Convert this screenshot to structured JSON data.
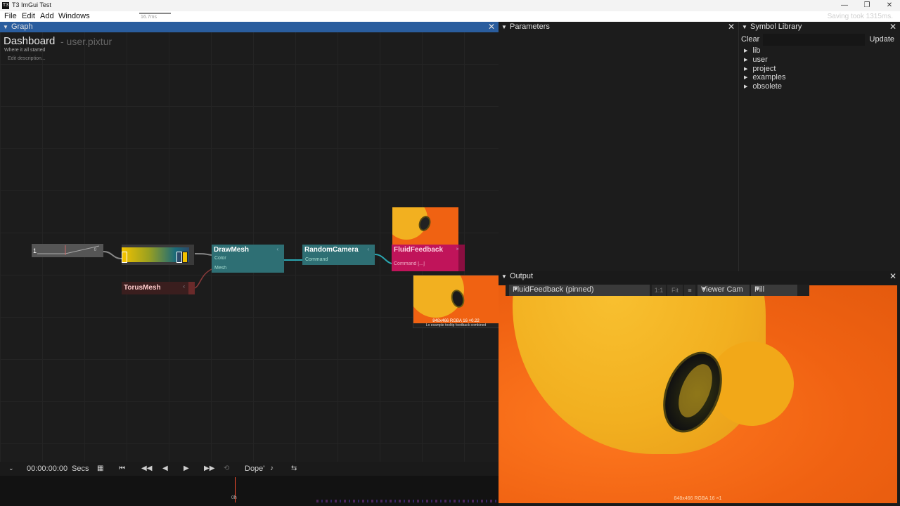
{
  "window": {
    "title": "T3 ImGui Test",
    "icon_text": "T3",
    "minimize": "—",
    "maximize": "❐",
    "close": "✕"
  },
  "menubar": {
    "items": [
      "File",
      "Edit",
      "Add",
      "Windows"
    ],
    "perf_label": "16.7ms",
    "status": "Saving took 1315ms."
  },
  "graph": {
    "title": "Graph",
    "dashboard_title": "Dashboard",
    "dashboard_path": "- user.pixtur",
    "description": "Where it all started",
    "edit_description": "Edit description...",
    "nodes": {
      "value": {
        "value": "1",
        "right_value": "0"
      },
      "drawmesh": {
        "label": "DrawMesh",
        "inputs": [
          "Color",
          "Mesh"
        ]
      },
      "randomcamera": {
        "label": "RandomCamera",
        "inputs": [
          "Command"
        ]
      },
      "fluidfeedback": {
        "label": "FluidFeedback",
        "inputs": [
          "Command [...]"
        ]
      },
      "torusmesh": {
        "label": "TorusMesh"
      }
    },
    "preview_caption": "848x466  RGBA 16  ×0.22",
    "preview_caption2": "Lo example tooltip feedback combined"
  },
  "parameters": {
    "title": "Parameters"
  },
  "symbol_library": {
    "title": "Symbol Library",
    "clear_label": "Clear",
    "update_label": "Update",
    "items": [
      "lib",
      "user",
      "project",
      "examples",
      "obsolete"
    ]
  },
  "output": {
    "title": "Output",
    "pinned_label": "FluidFeedback (pinned)",
    "ratio_label": "1:1",
    "fit_label": "Fit",
    "camera_label": "Viewer Cam",
    "fill_label": "Fill",
    "caption": "848x466  RGBA 16  ×1"
  },
  "timeline": {
    "time": "00:00:00:00",
    "unit": "Secs",
    "mode": "Dope'",
    "zero": "0h"
  },
  "colors": {
    "graph_header": "#2a5d9e",
    "node_teal": "#2e6f74",
    "node_pink": "#c0145a",
    "node_torus": "#4a2222",
    "render_orange": "#f06212",
    "render_yellow": "#f2b020"
  }
}
